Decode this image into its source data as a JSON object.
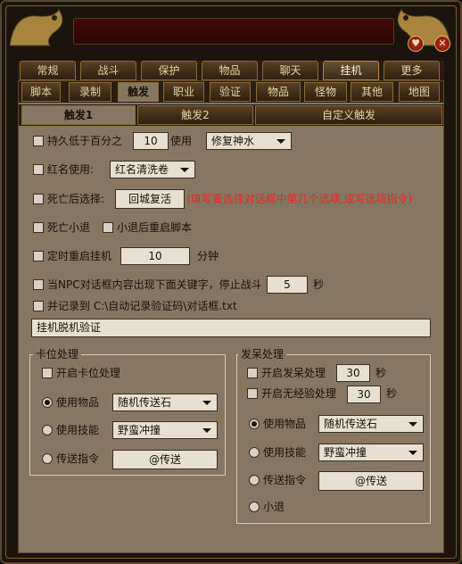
{
  "window": {
    "minimize_icon": "heart-minimize-icon",
    "close_icon": "close-icon",
    "accent": "#e8281e"
  },
  "tabs_main": [
    "常规",
    "战斗",
    "保护",
    "物品",
    "聊天",
    "挂机",
    "更多"
  ],
  "tabs_sub": [
    "脚本",
    "录制",
    "触发",
    "职业",
    "验证",
    "物品",
    "怪物",
    "其他",
    "地图"
  ],
  "tabs_trigger": [
    "触发1",
    "触发2",
    "自定义触发"
  ],
  "options": {
    "hp_low": {
      "label": "持久低于百分之",
      "value": "10",
      "use_label": "使用",
      "item": "修复神水"
    },
    "red_name": {
      "label": "红名使用:",
      "item": "红名清洗卷"
    },
    "death": {
      "label": "死亡后选择:",
      "button": "回城复活",
      "hint": "(填写要选择对话框中第几个选项,或写选项指令)"
    },
    "death_logout": {
      "label": "死亡小退"
    },
    "restart_after_logout": {
      "label": "小退后重启脚本"
    },
    "timed_restart": {
      "label": "定时重启挂机",
      "value": "10",
      "unit": "分钟"
    },
    "npc_stop": {
      "label": "当NPC对话框内容出现下面关键字，停止战斗",
      "value": "5",
      "unit": "秒"
    },
    "record_to": {
      "label": "并记录到 C:\\自动记录验证码\\对话框.txt"
    },
    "keyword": "挂机脱机验证"
  },
  "stuck": {
    "title": "卡位处理",
    "enable": "开启卡位处理",
    "use_item": "使用物品",
    "item_value": "随机传送石",
    "use_skill": "使用技能",
    "skill_value": "野蛮冲撞",
    "command": "传送指令",
    "command_value": "@传送"
  },
  "idle": {
    "title": "发呆处理",
    "enable": "开启发呆处理",
    "enable_value": "30",
    "noexp": "开启无经验处理",
    "noexp_value": "30",
    "unit": "秒",
    "use_item": "使用物品",
    "item_value": "随机传送石",
    "use_skill": "使用技能",
    "skill_value": "野蛮冲撞",
    "command": "传送指令",
    "command_value": "@传送",
    "logout": "小退"
  }
}
